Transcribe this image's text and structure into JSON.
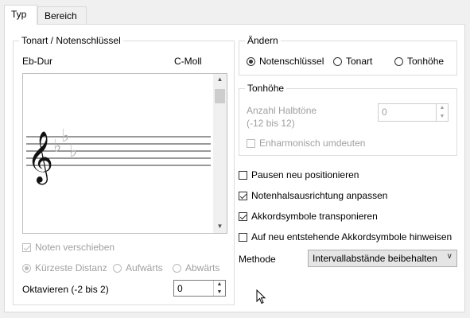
{
  "tabs": [
    {
      "label": "Typ"
    },
    {
      "label": "Bereich"
    }
  ],
  "key_group": {
    "title": "Tonart / Notenschlüssel",
    "from_key": "Eb-Dur",
    "to_key": "C-Moll",
    "move_notes_label": "Noten verschieben",
    "direction_options": [
      "Kürzeste Distanz",
      "Aufwärts",
      "Abwärts"
    ],
    "octave_label": "Oktavieren (-2 bis 2)",
    "octave_value": "0"
  },
  "change_group": {
    "title": "Ändern",
    "options": [
      "Notenschlüssel",
      "Tonart",
      "Tonhöhe"
    ]
  },
  "pitch_group": {
    "title": "Tonhöhe",
    "semitones_label_line1": "Anzahl Halbtöne",
    "semitones_label_line2": "(-12 bis 12)",
    "semitones_value": "0",
    "enharmonic_label": "Enharmonisch umdeuten"
  },
  "checks": [
    {
      "label": "Pausen neu positionieren",
      "checked": false
    },
    {
      "label": "Notenhalsausrichtung anpassen",
      "checked": true
    },
    {
      "label": "Akkordsymbole transponieren",
      "checked": true
    },
    {
      "label": "Auf neu entstehende Akkordsymbole hinweisen",
      "checked": false
    }
  ],
  "method": {
    "label": "Methode",
    "value": "Intervallabstände beibehalten"
  }
}
